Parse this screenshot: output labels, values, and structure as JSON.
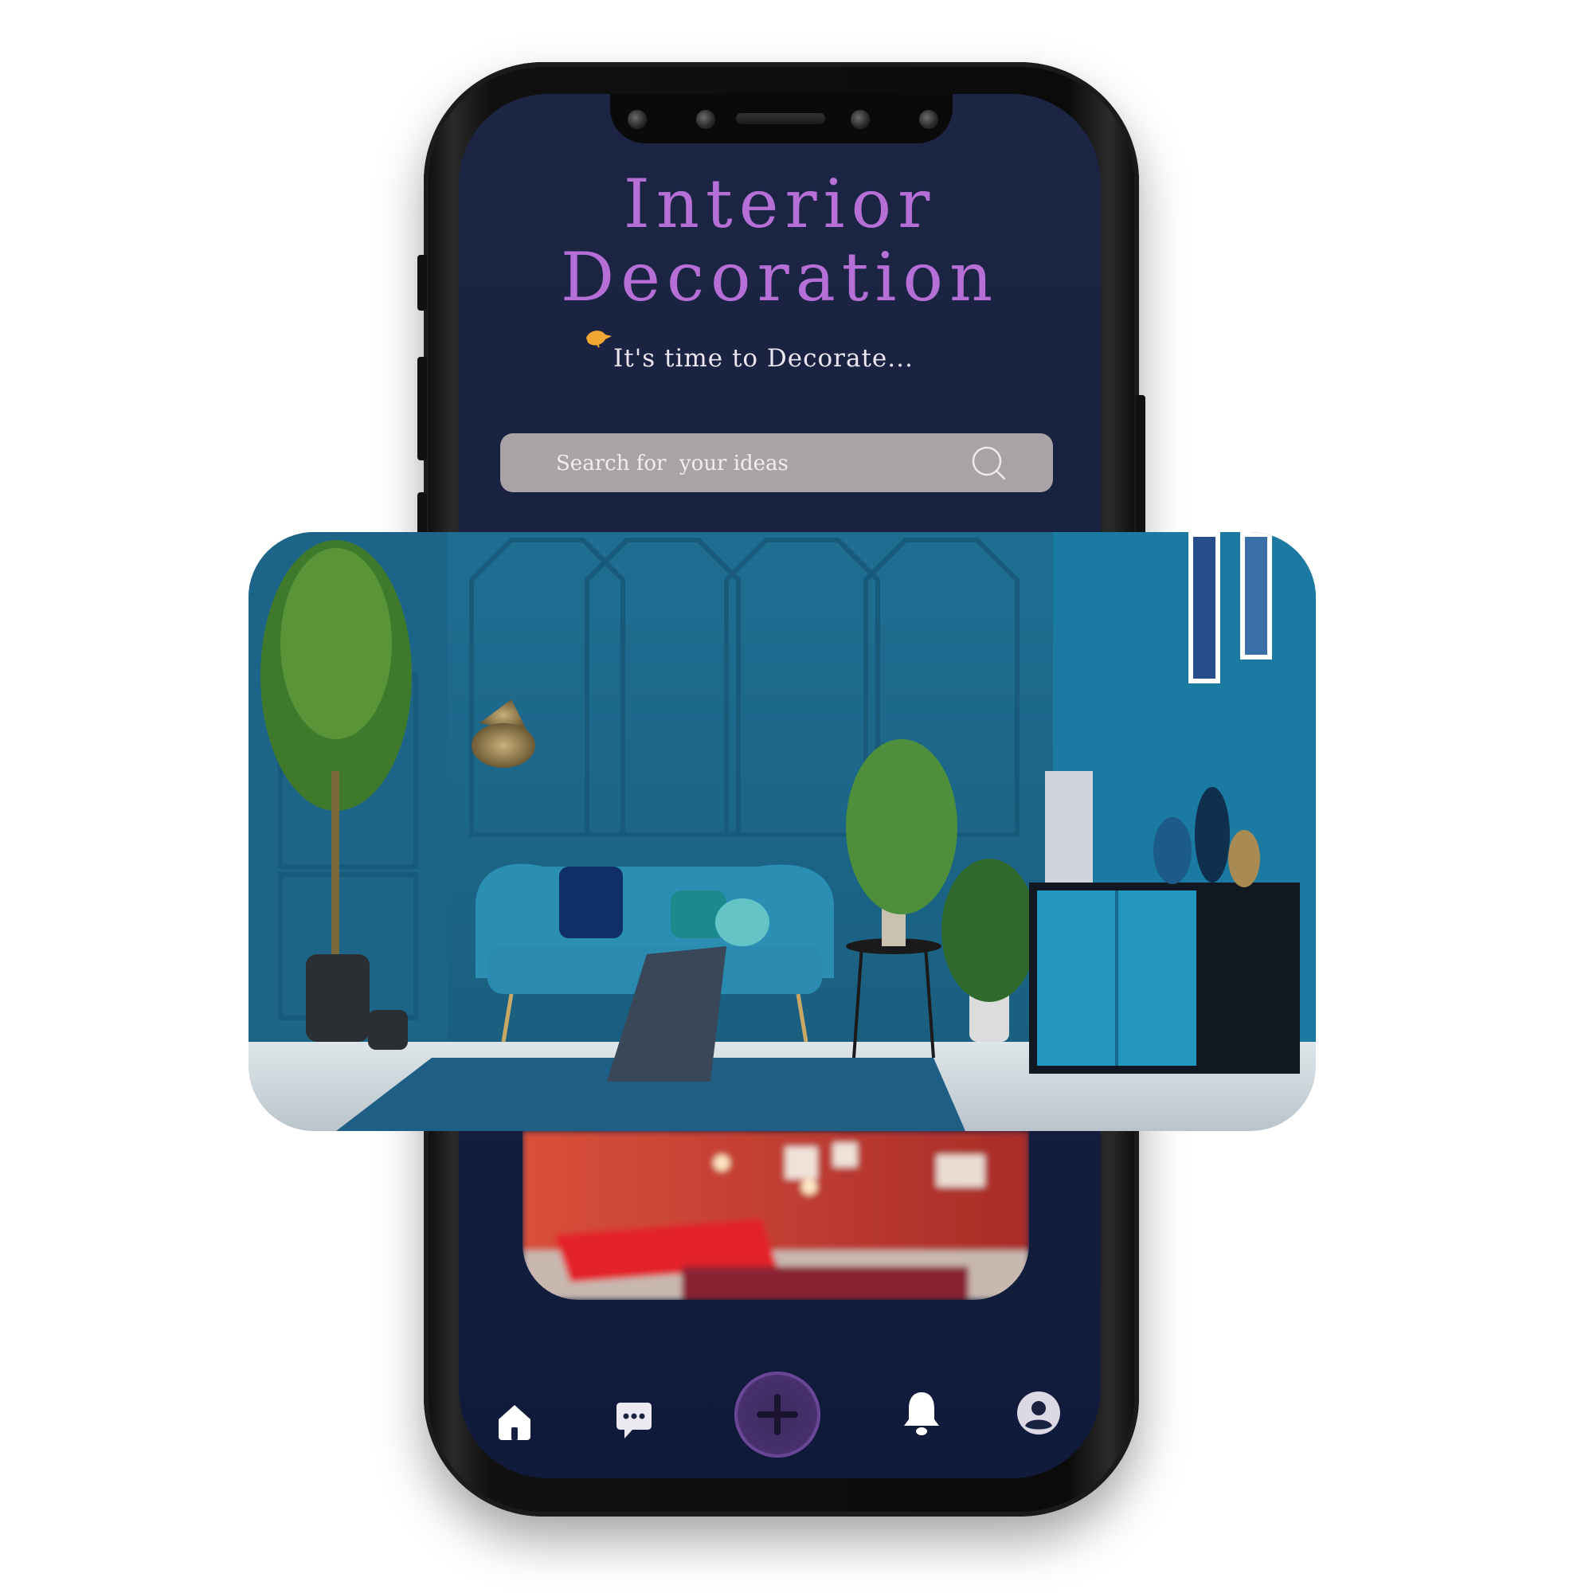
{
  "header": {
    "title_line1": "Interior",
    "title_line2": "Decoration",
    "tagline": "It's time to Decorate..."
  },
  "search": {
    "placeholder": "Search for  your ideas",
    "value": ""
  },
  "nav": {
    "items": [
      "home-icon",
      "chat-icon",
      "add-icon",
      "bell-icon",
      "profile-icon"
    ]
  },
  "colors": {
    "screen_bg": "#1a2242",
    "title": "#b56fd6",
    "search_bg": "#a9a2a7",
    "accent_button": "#47306c",
    "wall_blue": "#1e6f94"
  }
}
